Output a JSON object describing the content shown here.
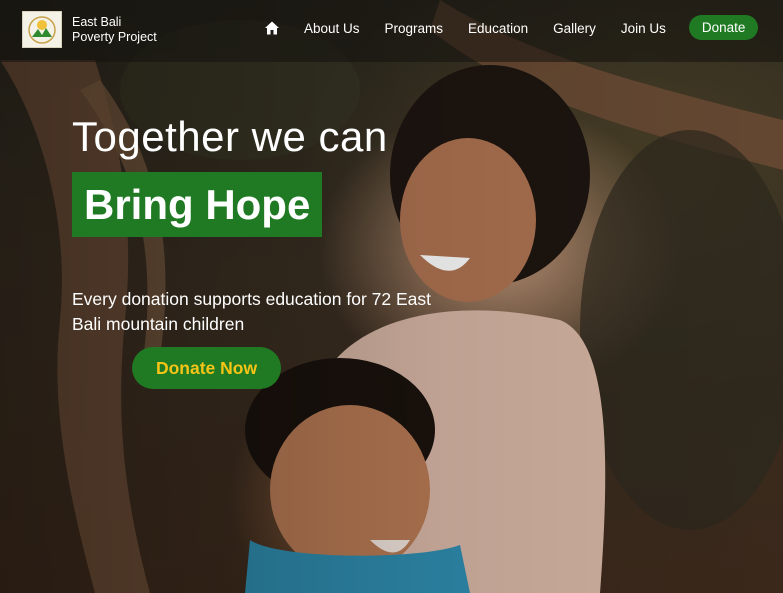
{
  "brand": {
    "line1": "East Bali",
    "line2": "Poverty Project",
    "logo_icon": "organization-logo-icon"
  },
  "nav": {
    "home_icon": "home-icon",
    "items": [
      "About Us",
      "Programs",
      "Education",
      "Gallery",
      "Join Us"
    ],
    "donate_label": "Donate"
  },
  "hero": {
    "heading": "Together we can",
    "highlight": "Bring Hope",
    "subtitle": "Every donation supports education for 72 East Bali mountain children",
    "cta_label": "Donate Now",
    "image": "photo-children-smiling"
  },
  "colors": {
    "accent_green": "#1f7a23",
    "cta_text_yellow": "#f5c417",
    "text_white": "#ffffff"
  }
}
